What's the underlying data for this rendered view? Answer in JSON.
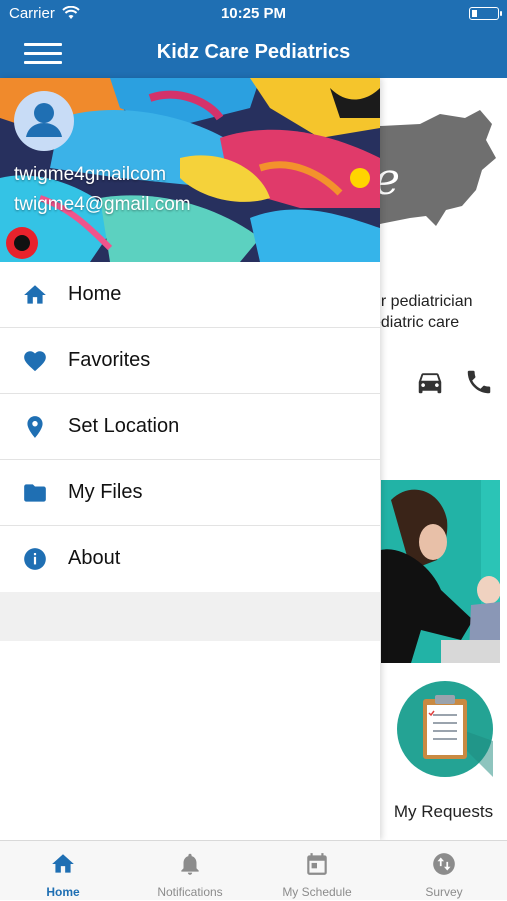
{
  "status_bar": {
    "carrier": "Carrier",
    "time": "10:25 PM"
  },
  "header": {
    "title": "Kidz Care Pediatrics"
  },
  "background_page": {
    "text_line1": "ur pediatrician",
    "text_line2": "ediatric care",
    "requests_label": "My Requests"
  },
  "drawer": {
    "user_name": "twigme4gmailcom",
    "user_email": "twigme4@gmail.com",
    "items": [
      {
        "label": "Home",
        "icon": "home-icon"
      },
      {
        "label": "Favorites",
        "icon": "heart-icon"
      },
      {
        "label": "Set Location",
        "icon": "location-pin-icon"
      },
      {
        "label": "My Files",
        "icon": "folder-icon"
      },
      {
        "label": "About",
        "icon": "info-icon"
      }
    ]
  },
  "tab_bar": {
    "tabs": [
      {
        "label": "Home",
        "icon": "home-icon",
        "active": true
      },
      {
        "label": "Notifications",
        "icon": "bell-icon",
        "active": false
      },
      {
        "label": "My Schedule",
        "icon": "calendar-icon",
        "active": false
      },
      {
        "label": "Survey",
        "icon": "swap-icon",
        "active": false
      }
    ]
  },
  "colors": {
    "primary": "#1f6fb3",
    "accent_teal": "#24a394",
    "tab_inactive": "#8c8c8c"
  }
}
